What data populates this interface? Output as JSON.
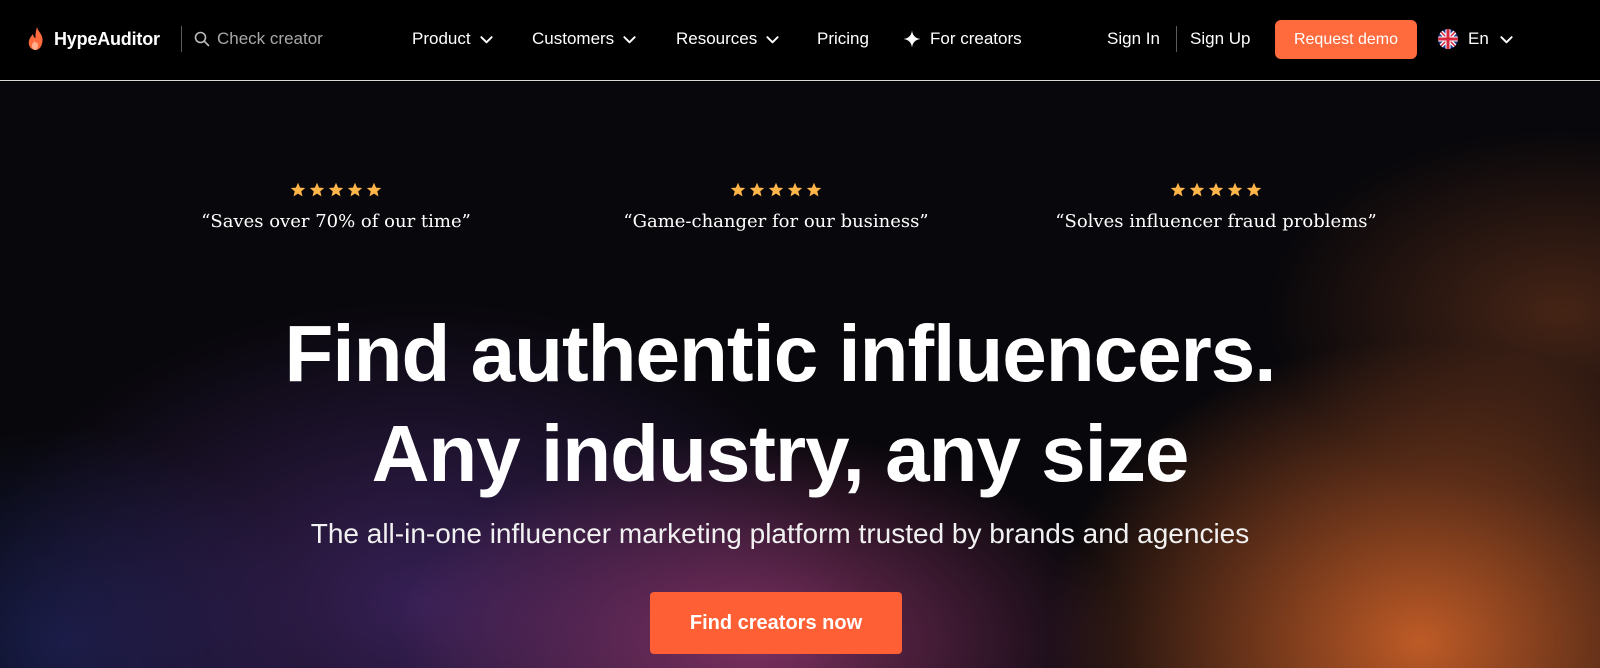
{
  "brand": {
    "name": "HypeAuditor",
    "color": "#ff6b3d"
  },
  "search": {
    "placeholder": "Check creator"
  },
  "nav": {
    "items": [
      {
        "label": "Product",
        "has_dropdown": true
      },
      {
        "label": "Customers",
        "has_dropdown": true
      },
      {
        "label": "Resources",
        "has_dropdown": true
      },
      {
        "label": "Pricing",
        "has_dropdown": false
      },
      {
        "label": "For creators",
        "icon": "sparkle-icon"
      }
    ],
    "sign_in": "Sign In",
    "sign_up": "Sign Up",
    "request_demo": "Request demo",
    "language": {
      "label": "En",
      "flag": "uk-flag-icon"
    }
  },
  "reviews": [
    {
      "stars": 5,
      "quote": "“Saves over 70% of our time”"
    },
    {
      "stars": 5,
      "quote": "“Game-changer for our business”"
    },
    {
      "stars": 5,
      "quote": "“Solves influencer fraud problems”"
    }
  ],
  "hero": {
    "headline_line1": "Find authentic influencers.",
    "headline_line2": "Any industry, any size",
    "subtitle": "The all-in-one influencer marketing platform trusted by brands and agencies",
    "cta": "Find creators now"
  },
  "colors": {
    "accent": "#ff6b3d",
    "star": "#ffb547",
    "background": "#000000"
  }
}
